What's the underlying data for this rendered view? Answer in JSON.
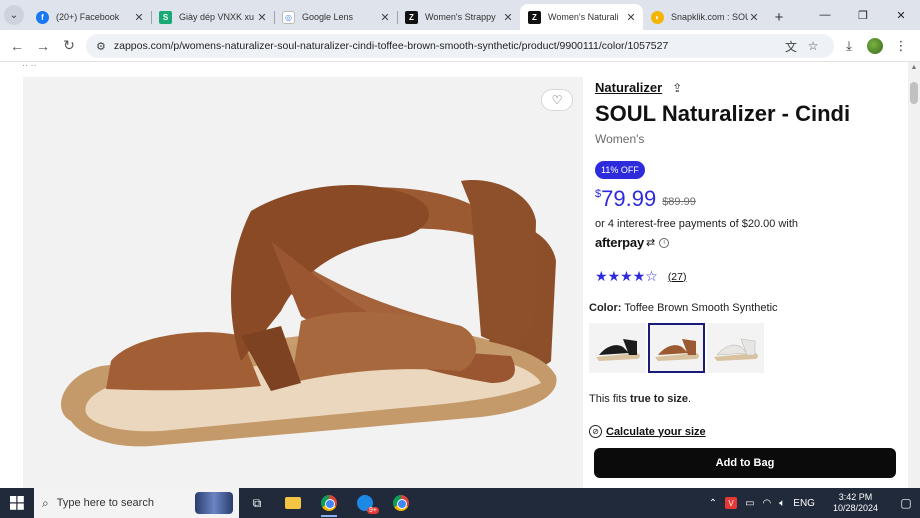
{
  "browser": {
    "tabs": [
      {
        "title": "(20+) Facebook",
        "favicon": "facebook-icon",
        "active": false
      },
      {
        "title": "Giày dép VNXK xu",
        "favicon": "s-icon",
        "active": false
      },
      {
        "title": "Google Lens",
        "favicon": "google-lens-icon",
        "active": false
      },
      {
        "title": "Women's Strappy",
        "favicon": "zappos-icon",
        "active": false
      },
      {
        "title": "Women's Naturali",
        "favicon": "zappos-icon",
        "active": true
      },
      {
        "title": "Snapklik.com : SOU",
        "favicon": "snapklik-icon",
        "active": false
      }
    ],
    "url": "zappos.com/p/womens-naturalizer-soul-naturalizer-cindi-toffee-brown-smooth-synthetic/product/9900111/color/1057527"
  },
  "product": {
    "brand": "Naturalizer",
    "title": "SOUL Naturalizer - Cindi",
    "gender": "Women's",
    "discount_badge": "11% OFF",
    "currency": "$",
    "price": "79.99",
    "original_price": "$89.99",
    "installments": "or 4 interest-free payments of $20.00 with",
    "afterpay_label": "afterpay",
    "rating": 4,
    "rating_max": 5,
    "review_count": "(27)",
    "color_label": "Color:",
    "color_value": "Toffee Brown Smooth Synthetic",
    "swatches": [
      {
        "name": "Black",
        "color": "#1c1c1c"
      },
      {
        "name": "Toffee Brown Smooth Synthetic",
        "color": "#9b5a32",
        "selected": true
      },
      {
        "name": "White",
        "color": "#e8e6e2"
      }
    ],
    "fit_prefix": "This fits ",
    "fit_value": "true to size",
    "fit_suffix": ".",
    "calc_size": "Calculate your size",
    "add_to_bag": "Add to Bag",
    "colors": {
      "accent": "#2d2bdb",
      "button": "#0b0b0b"
    }
  },
  "taskbar": {
    "search_placeholder": "Type here to search",
    "language": "ENG",
    "time": "3:42 PM",
    "date": "10/28/2024",
    "messenger_badge": "9+"
  }
}
